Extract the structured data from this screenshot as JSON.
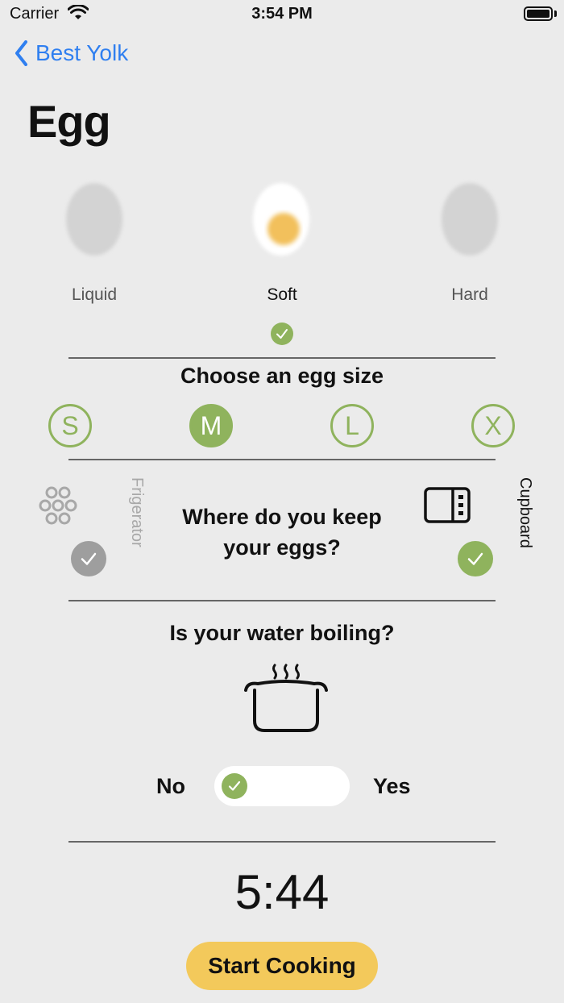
{
  "status": {
    "carrier": "Carrier",
    "time": "3:54 PM"
  },
  "nav": {
    "back_label": "Best Yolk"
  },
  "page": {
    "title": "Egg"
  },
  "doneness": {
    "options": [
      {
        "label": "Liquid",
        "selected": false
      },
      {
        "label": "Soft",
        "selected": true
      },
      {
        "label": "Hard",
        "selected": false
      }
    ]
  },
  "size": {
    "title": "Choose an egg size",
    "options": [
      {
        "label": "S",
        "selected": false
      },
      {
        "label": "M",
        "selected": true
      },
      {
        "label": "L",
        "selected": false
      },
      {
        "label": "X",
        "selected": false
      }
    ]
  },
  "storage": {
    "question": "Where do you keep your eggs?",
    "left_label": "Frigerator",
    "right_label": "Cupboard",
    "selected": "Cupboard"
  },
  "water": {
    "question": "Is your water boiling?",
    "no_label": "No",
    "yes_label": "Yes",
    "boiling": false
  },
  "timer": {
    "value": "5:44"
  },
  "actions": {
    "start_label": "Start Cooking"
  },
  "colors": {
    "accent_green": "#8fb35d",
    "button_yellow": "#f3c95b",
    "link_blue": "#2f7ff0",
    "muted_gray": "#9e9e9e"
  }
}
